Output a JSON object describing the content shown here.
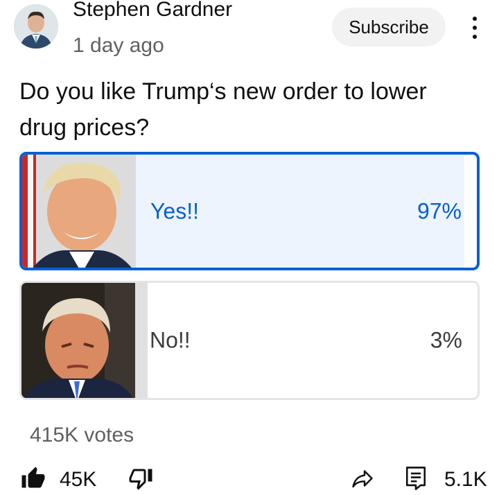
{
  "post": {
    "author": "Stephen Gardner",
    "time": "1 day ago",
    "subscribe_label": "Subscribe",
    "question": "Do you like Trump‘s new order to lower drug prices?"
  },
  "poll": {
    "options": [
      {
        "label": "Yes!!",
        "percent": "97%",
        "share": 0.97,
        "selected": true
      },
      {
        "label": "No!!",
        "percent": "3%",
        "share": 0.03,
        "selected": false
      }
    ],
    "votes": "415K votes"
  },
  "actions": {
    "likes": "45K",
    "comments": "5.1K"
  },
  "colors": {
    "accent": "#065fd4",
    "selected_fill": "#eef4fd",
    "muted_text": "#606060"
  },
  "icons": [
    "avatar-photo",
    "more-vert-icon",
    "thumb-up-filled-icon",
    "thumb-down-outline-icon",
    "share-arrow-icon",
    "comment-icon"
  ]
}
